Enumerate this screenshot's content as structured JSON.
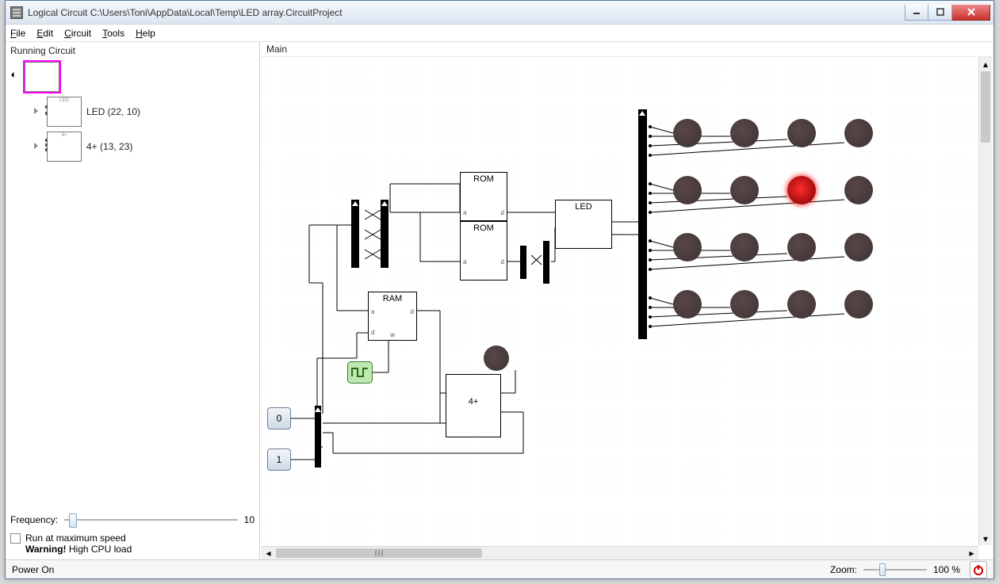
{
  "window": {
    "title": "Logical Circuit C:\\Users\\Toni\\AppData\\Local\\Temp\\LED array.CircuitProject"
  },
  "menu": {
    "file": "File",
    "edit": "Edit",
    "circuit": "Circuit",
    "tools": "Tools",
    "help": "Help"
  },
  "sidebar": {
    "header": "Running Circuit",
    "items": [
      {
        "label": "",
        "kind": "root",
        "selected": true
      },
      {
        "label": "LED  (22, 10)",
        "kind": "module"
      },
      {
        "label": "4+  (13, 23)",
        "kind": "module"
      }
    ],
    "frequency_label": "Frequency:",
    "frequency_value": "10",
    "max_speed_label": "Run at maximum speed",
    "warning_bold": "Warning!",
    "warning_rest": " High CPU load"
  },
  "main": {
    "header": "Main",
    "chips": {
      "rom1": "ROM",
      "rom2": "ROM",
      "ram": "RAM",
      "led": "LED",
      "adder": "4+",
      "pin_a": "a",
      "pin_d": "d",
      "pin_w": "w"
    },
    "const0": "0",
    "const1": "1"
  },
  "statusbar": {
    "status": "Power On",
    "zoom_label": "Zoom:",
    "zoom_value": "100 %"
  },
  "colors": {
    "led_off": "#3d3333",
    "led_on": "#ff2b2b",
    "clock_bg": "#bfe8b0"
  }
}
